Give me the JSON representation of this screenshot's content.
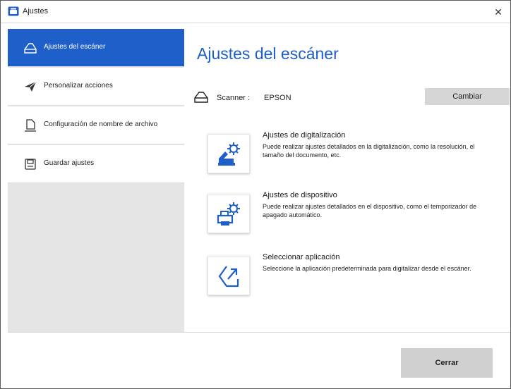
{
  "window": {
    "title": "Ajustes",
    "close_glyph": "✕"
  },
  "sidebar": {
    "items": [
      {
        "label": "Ajustes del escáner",
        "icon": "scanner-icon",
        "active": true
      },
      {
        "label": "Personalizar acciones",
        "icon": "send-icon",
        "active": false
      },
      {
        "label": "Configuración de nombre de archivo",
        "icon": "document-icon",
        "active": false
      },
      {
        "label": "Guardar ajustes",
        "icon": "save-icon",
        "active": false
      }
    ]
  },
  "main": {
    "title": "Ajustes del escáner",
    "scanner_label": "Scanner :",
    "scanner_value": "EPSON",
    "change_button": "Cambiar",
    "options": [
      {
        "title": "Ajustes de digitalización",
        "description": "Puede realizar ajustes detallados en la digitalización, como la resolución, el tamaño del documento, etc.",
        "icon": "scan-settings-icon"
      },
      {
        "title": "Ajustes de dispositivo",
        "description": "Puede realizar ajustes detallados en el dispositivo, como el temporizador de apagado automático.",
        "icon": "device-settings-icon"
      },
      {
        "title": "Seleccionar aplicación",
        "description": "Seleccione la aplicación predeterminada para digitalizar desde el escáner.",
        "icon": "select-app-icon"
      }
    ]
  },
  "footer": {
    "close_button": "Cerrar"
  },
  "colors": {
    "accent": "#1f5fc9",
    "sidebar_bg": "#e5e5e5",
    "button_bg": "#d6d6d6"
  }
}
